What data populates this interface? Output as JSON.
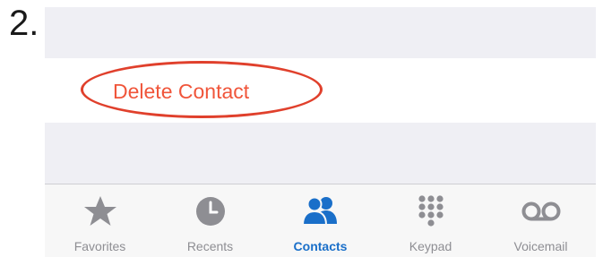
{
  "step_number": "2.",
  "action": {
    "label": "Delete Contact",
    "color": "#f0553a",
    "highlight_color": "#e0402c"
  },
  "tabbar": {
    "active_color": "#1a6fc9",
    "inactive_color": "#8e8e93",
    "tabs": [
      {
        "label": "Favorites",
        "icon": "star-icon",
        "active": false
      },
      {
        "label": "Recents",
        "icon": "clock-icon",
        "active": false
      },
      {
        "label": "Contacts",
        "icon": "contacts-icon",
        "active": true
      },
      {
        "label": "Keypad",
        "icon": "keypad-icon",
        "active": false
      },
      {
        "label": "Voicemail",
        "icon": "voicemail-icon",
        "active": false
      }
    ]
  }
}
